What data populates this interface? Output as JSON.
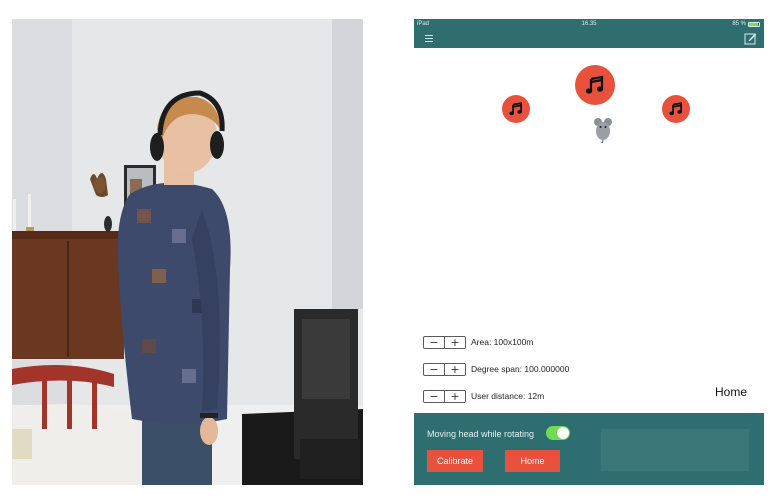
{
  "status_bar": {
    "carrier": "iPad",
    "time": "16.35",
    "battery": "85 %",
    "battery_level": 0.85
  },
  "nav": {
    "menu_icon": "hamburger-icon",
    "compose_icon": "compose-icon"
  },
  "sound_sources": [
    {
      "id": "top",
      "icon": "music-note-icon"
    },
    {
      "id": "left",
      "icon": "music-note-icon"
    },
    {
      "id": "right",
      "icon": "music-note-icon"
    }
  ],
  "controls": {
    "area_label": "Area: 100x100m",
    "degree_label": "Degree span: 100.000000",
    "distance_label": "User distance: 12m",
    "minus": "−",
    "plus": "+"
  },
  "location_label": "Home",
  "bottom": {
    "toggle_label": "Moving head while rotating",
    "toggle_on": true,
    "calibrate_label": "Calibrate",
    "home_label": "Home"
  },
  "colors": {
    "teal": "#2f6e70",
    "accent": "#e8513b",
    "toggle_on": "#6fdc53"
  }
}
